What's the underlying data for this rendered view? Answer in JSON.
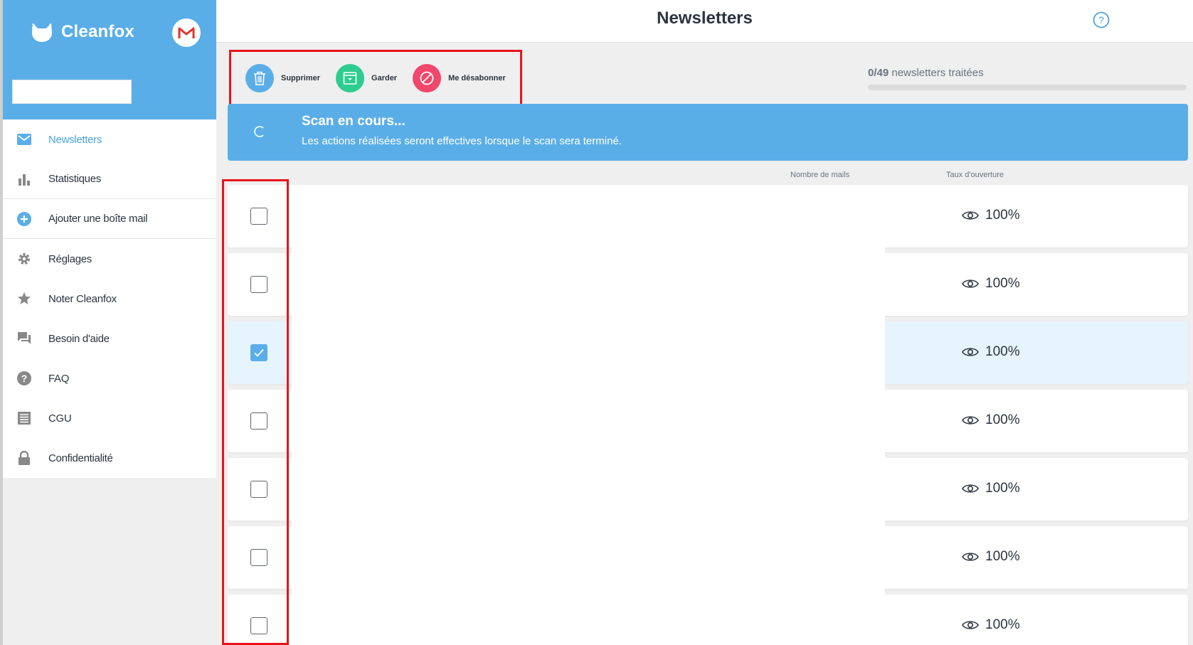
{
  "brand": {
    "name": "Cleanfox",
    "accent": "#5aaee8"
  },
  "account": {
    "provider_icon": "gmail-icon"
  },
  "sidebar": {
    "items": [
      {
        "label": "Newsletters",
        "icon": "envelope-icon",
        "active": true
      },
      {
        "label": "Statistiques",
        "icon": "bar-chart-icon"
      },
      {
        "label": "Ajouter une boîte mail",
        "icon": "plus-circle-icon"
      },
      {
        "label": "Réglages",
        "icon": "gear-icon"
      },
      {
        "label": "Noter Cleanfox",
        "icon": "star-icon"
      },
      {
        "label": "Besoin d'aide",
        "icon": "chat-icon"
      },
      {
        "label": "FAQ",
        "icon": "question-circle-icon"
      },
      {
        "label": "CGU",
        "icon": "document-icon"
      },
      {
        "label": "Confidentialité",
        "icon": "lock-icon"
      }
    ]
  },
  "header": {
    "title": "Newsletters",
    "help_icon": "help-icon"
  },
  "actions": {
    "delete": {
      "label": "Supprimer",
      "color": "#5aaee8"
    },
    "keep": {
      "label": "Garder",
      "color": "#2ecc8f"
    },
    "unsubscribe": {
      "label": "Me désabonner",
      "color": "#f0476b"
    }
  },
  "progress": {
    "done": "0/49",
    "label": " newsletters traitées",
    "fraction": 0
  },
  "scan": {
    "title": "Scan en cours...",
    "subtitle": "Les actions réalisées seront effectives lorsque le scan sera terminé."
  },
  "columns": {
    "mails": "Nombre de mails",
    "open_rate": "Taux d'ouverture"
  },
  "rows": [
    {
      "checked": false,
      "open_rate": "100%"
    },
    {
      "checked": false,
      "open_rate": "100%"
    },
    {
      "checked": true,
      "open_rate": "100%"
    },
    {
      "checked": false,
      "open_rate": "100%"
    },
    {
      "checked": false,
      "open_rate": "100%"
    },
    {
      "checked": false,
      "open_rate": "100%"
    },
    {
      "checked": false,
      "open_rate": "100%"
    }
  ]
}
